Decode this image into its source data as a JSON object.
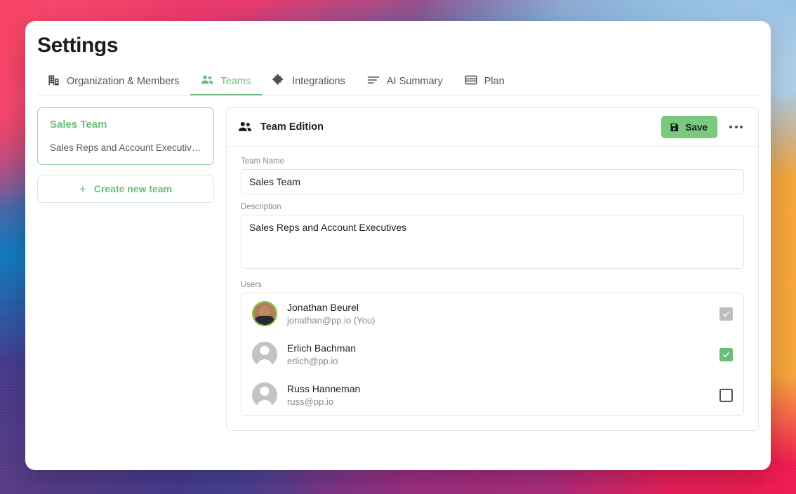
{
  "window": {
    "title": "Settings"
  },
  "tabs": [
    {
      "label": "Organization & Members",
      "icon": "building-icon",
      "active": false
    },
    {
      "label": "Teams",
      "icon": "people-icon",
      "active": true
    },
    {
      "label": "Integrations",
      "icon": "puzzle-icon",
      "active": false
    },
    {
      "label": "AI Summary",
      "icon": "text-lines-icon",
      "active": false
    },
    {
      "label": "Plan",
      "icon": "credit-card-icon",
      "active": false
    }
  ],
  "sidebar": {
    "teams": [
      {
        "name": "Sales Team",
        "description": "Sales Reps and Account Executives...",
        "selected": true
      }
    ],
    "create_team_label": "Create new team",
    "create_team_icon": "plus-icon"
  },
  "panel": {
    "header": {
      "icon": "people-icon",
      "title": "Team Edition",
      "save_label": "Save",
      "save_icon": "save-disk-icon",
      "menu_icon": "kebab-menu-icon"
    },
    "fields": {
      "team_name_label": "Team Name",
      "team_name_value": "Sales Team",
      "team_name_placeholder": "Team Name",
      "description_label": "Description",
      "description_value": "Sales Reps and Account Executives",
      "description_placeholder": "Description",
      "users_label": "Users"
    },
    "users": [
      {
        "name": "Jonathan Beurel",
        "email": "jonathan@pp.io (You)",
        "avatar_type": "photo",
        "avatar_ring": true,
        "checkbox_state": "checked-disabled"
      },
      {
        "name": "Erlich Bachman",
        "email": "erlich@pp.io",
        "avatar_type": "placeholder",
        "avatar_ring": false,
        "checkbox_state": "checked"
      },
      {
        "name": "Russ Hanneman",
        "email": "russ@pp.io",
        "avatar_type": "placeholder",
        "avatar_ring": false,
        "checkbox_state": "unchecked"
      }
    ]
  },
  "colors": {
    "accent_green": "#6bbd78",
    "save_button_green": "#7ac97e",
    "avatar_ring_green": "#7ec242",
    "text_primary": "#1f1f1f",
    "text_muted": "#8a8a8a"
  }
}
